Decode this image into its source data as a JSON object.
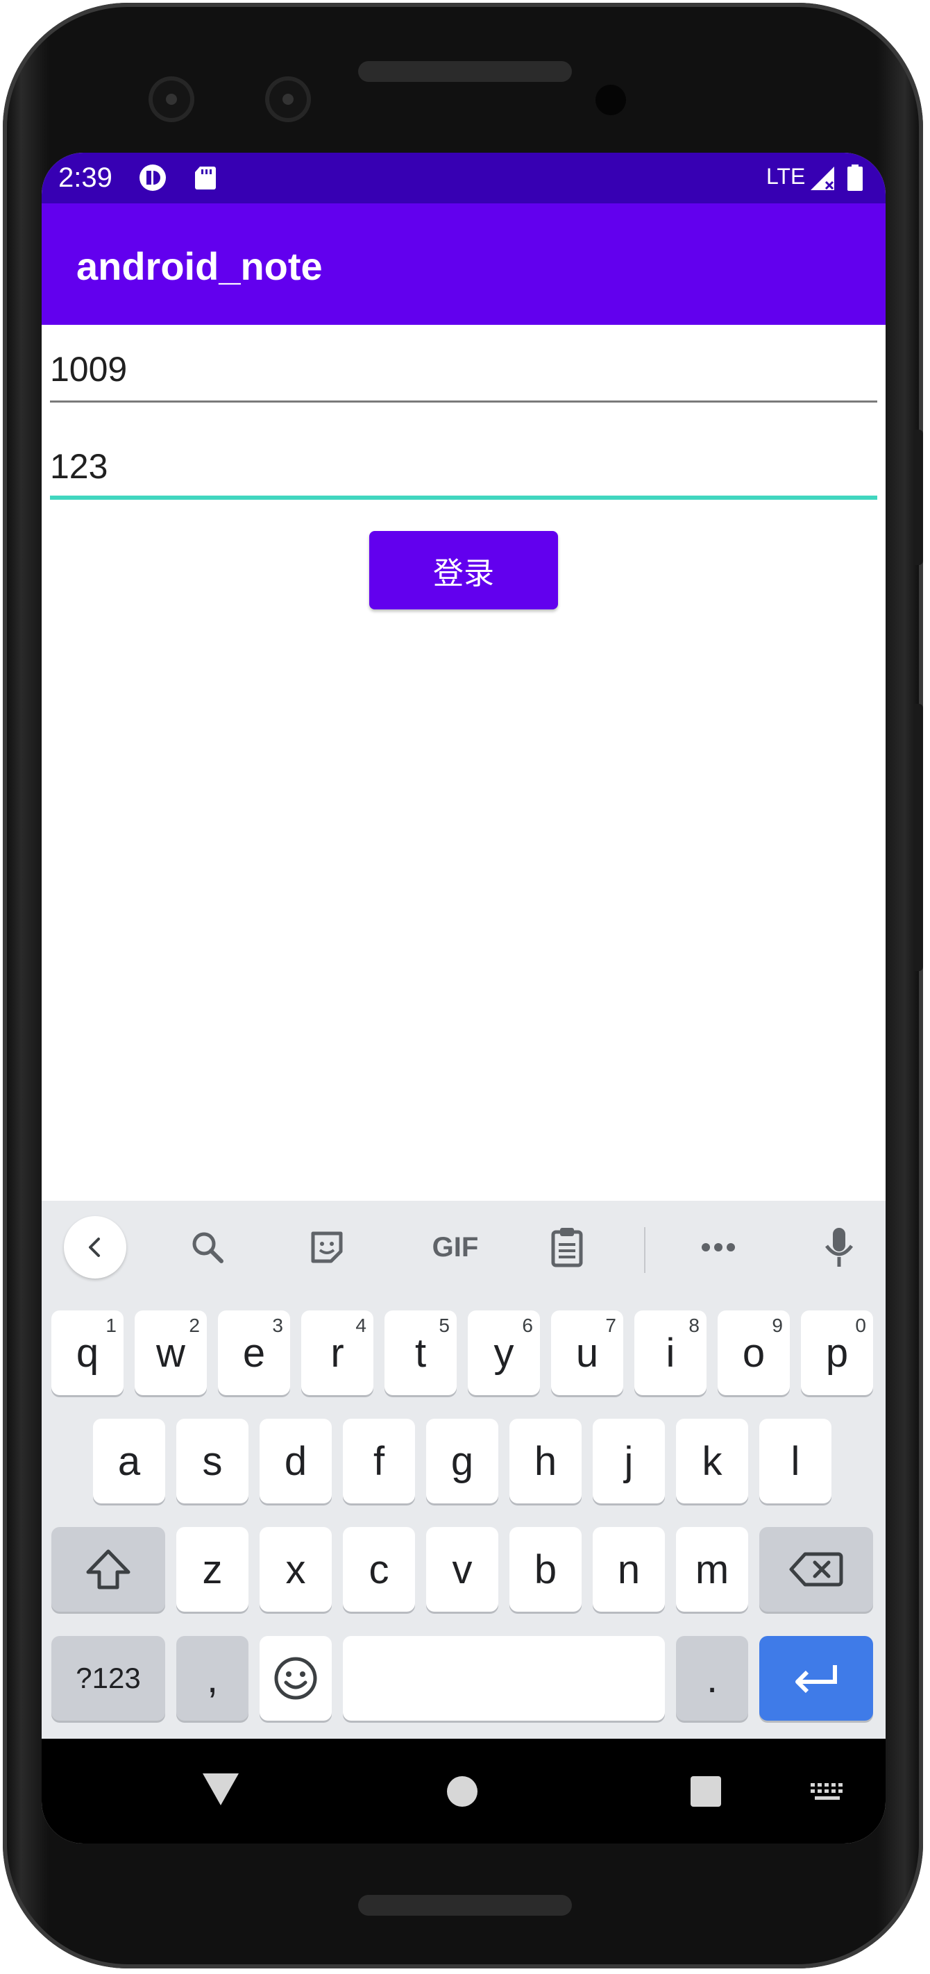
{
  "status_bar": {
    "time": "2:39",
    "network": "LTE",
    "icons": [
      "media-playback-icon",
      "sd-card-icon",
      "signal-icon",
      "battery-icon"
    ]
  },
  "app_bar": {
    "title": "android_note"
  },
  "form": {
    "username": "1009",
    "password": "123",
    "login_label": "登录"
  },
  "keyboard": {
    "toolbar": [
      "back-chevron-icon",
      "search-icon",
      "sticker-icon",
      "GIF",
      "clipboard-icon",
      "more-icon",
      "microphone-icon"
    ],
    "row1": [
      {
        "key": "q",
        "hint": "1"
      },
      {
        "key": "w",
        "hint": "2"
      },
      {
        "key": "e",
        "hint": "3"
      },
      {
        "key": "r",
        "hint": "4"
      },
      {
        "key": "t",
        "hint": "5"
      },
      {
        "key": "y",
        "hint": "6"
      },
      {
        "key": "u",
        "hint": "7"
      },
      {
        "key": "i",
        "hint": "8"
      },
      {
        "key": "o",
        "hint": "9"
      },
      {
        "key": "p",
        "hint": "0"
      }
    ],
    "row2": [
      "a",
      "s",
      "d",
      "f",
      "g",
      "h",
      "j",
      "k",
      "l"
    ],
    "row3": [
      "z",
      "x",
      "c",
      "v",
      "b",
      "n",
      "m"
    ],
    "symbols_label": "?123",
    "comma": ",",
    "period": "."
  },
  "colors": {
    "status_bar": "#3700b3",
    "primary": "#6200ee",
    "focus_underline": "#41d6bf",
    "enter_key": "#3f7be8"
  }
}
